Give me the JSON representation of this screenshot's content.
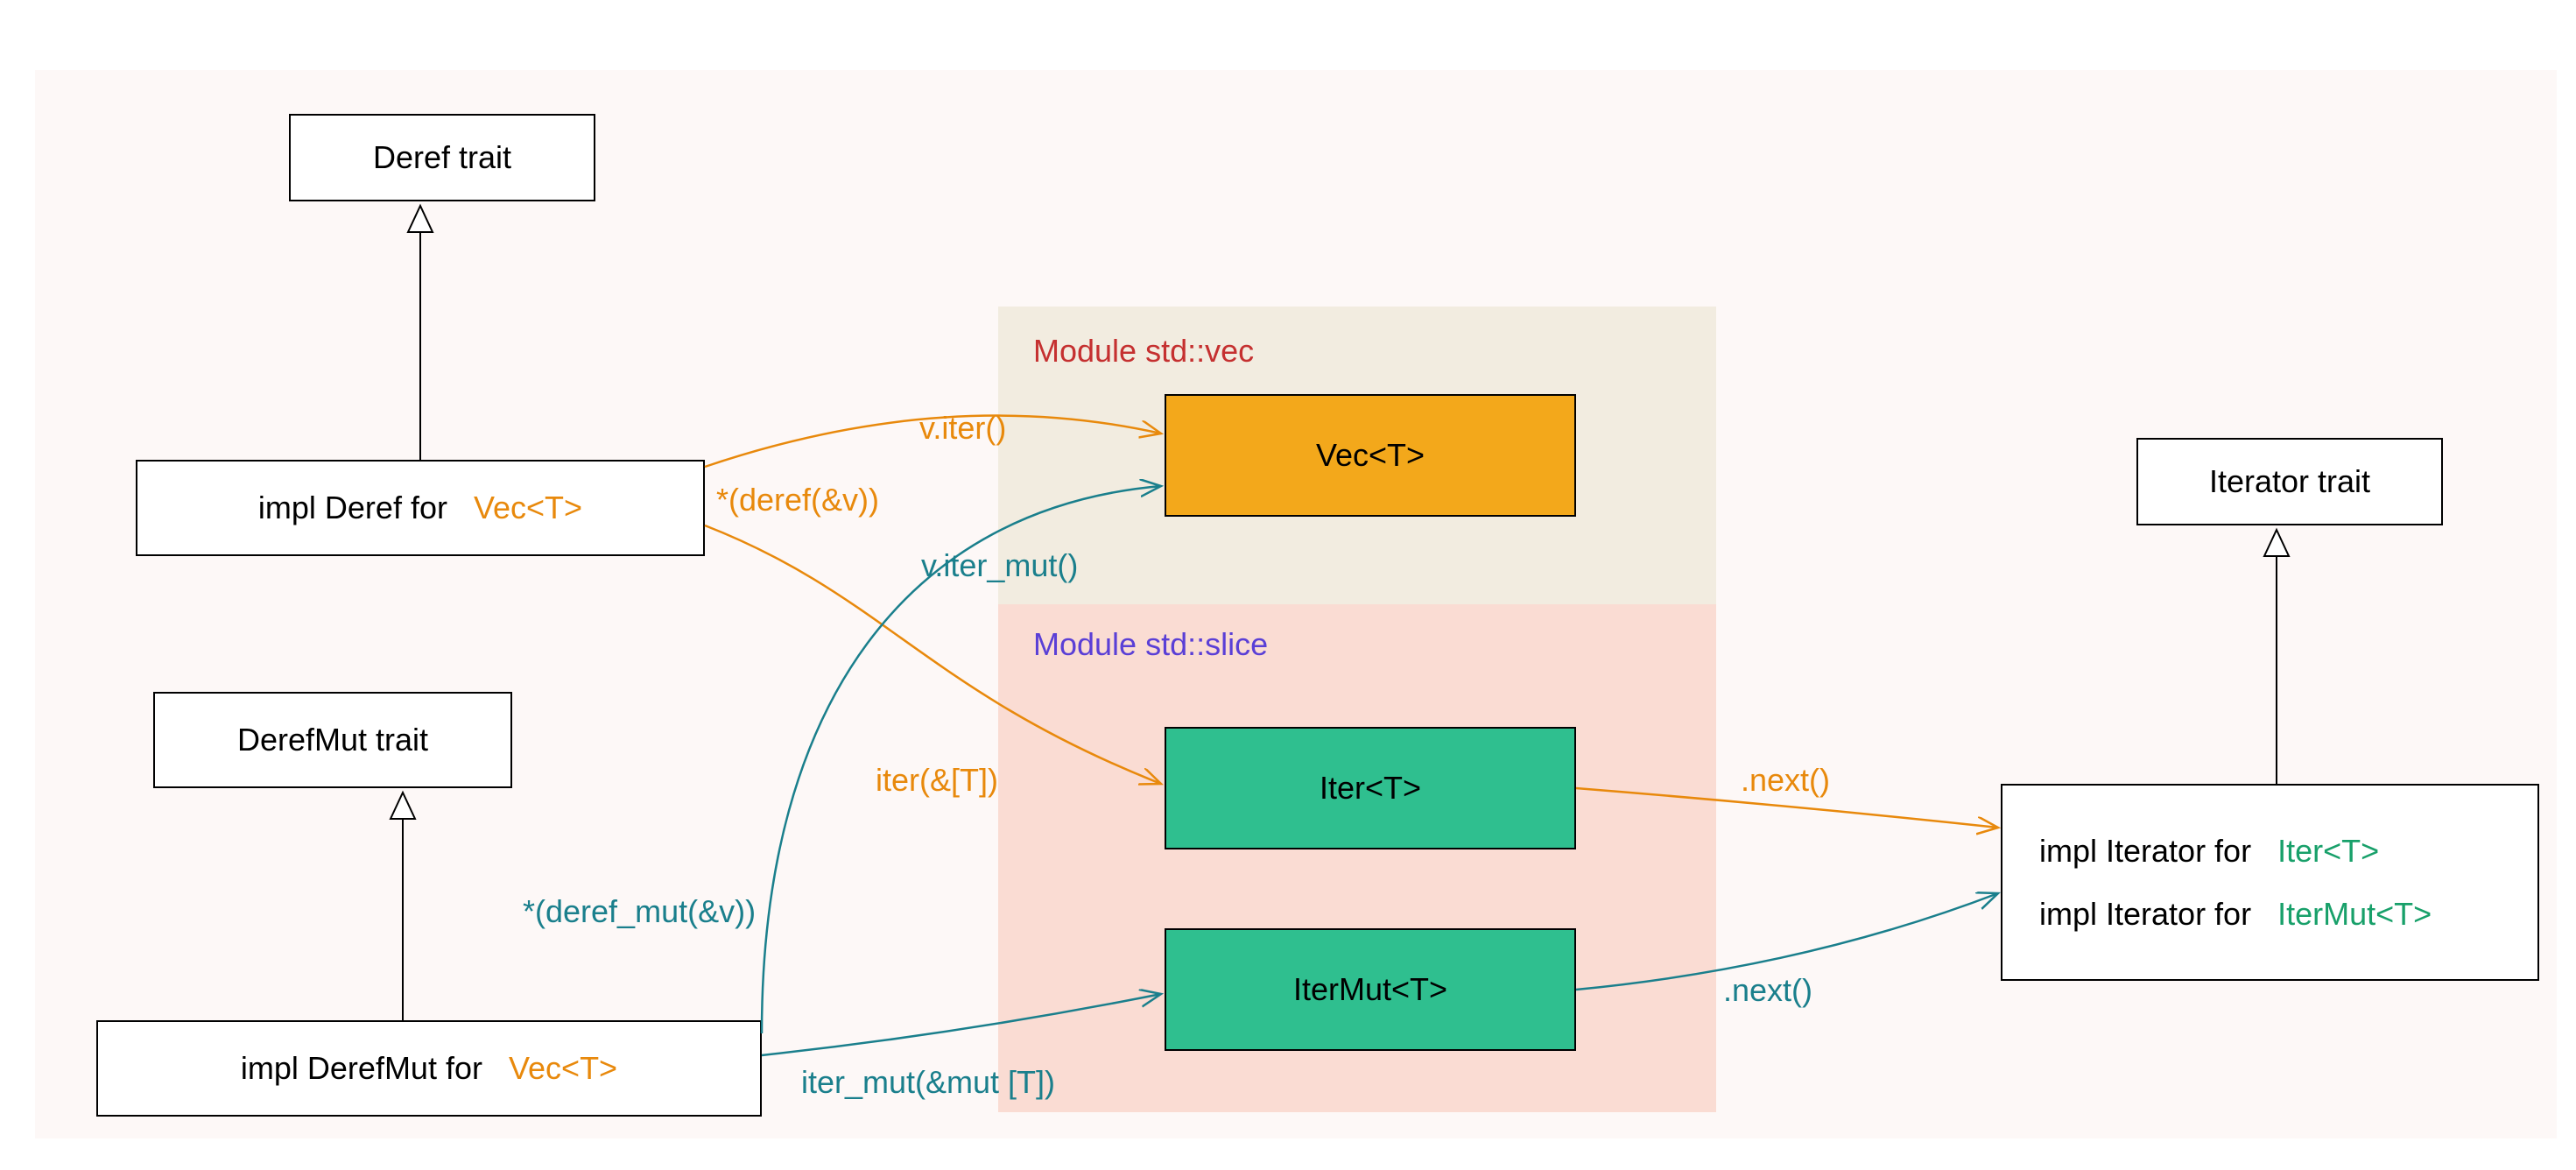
{
  "colors": {
    "orange": "#e8890c",
    "teal": "#1a7f8c",
    "green": "#18a06a",
    "purple": "#5a3fd6",
    "red": "#c53030",
    "vec_fill": "#f3a81b",
    "iter_fill": "#2fbf8f",
    "vec_module_bg": "#f2ece0",
    "slice_module_bg": "#fadcd3",
    "outer_bg": "#fdf8f7"
  },
  "left": {
    "deref_trait": "Deref trait",
    "impl_deref_prefix": "impl Deref for",
    "impl_deref_type": "Vec<T>",
    "derefmut_trait": "DerefMut trait",
    "impl_derefmut_prefix": "impl DerefMut for",
    "impl_derefmut_type": "Vec<T>"
  },
  "modules": {
    "vec_title": "Module std::vec",
    "slice_title": "Module std::slice",
    "vec_box": "Vec<T>",
    "iter_box": "Iter<T>",
    "itermut_box": "IterMut<T>"
  },
  "edge_labels": {
    "v_iter": "v.iter()",
    "deref_call": "*(deref(&v))",
    "v_iter_mut": "v.iter_mut()",
    "derefmut_call": "*(deref_mut(&v))",
    "iter_slice": "iter(&[T])",
    "iter_mut_slice": "iter_mut(&mut [T])",
    "next_iter": ".next()",
    "next_itermut": ".next()"
  },
  "right": {
    "iterator_trait": "Iterator trait",
    "impl_iter_prefix": "impl Iterator for",
    "impl_iter_type": "Iter<T>",
    "impl_itermut_prefix": "impl Iterator for",
    "impl_itermut_type": "IterMut<T>"
  }
}
